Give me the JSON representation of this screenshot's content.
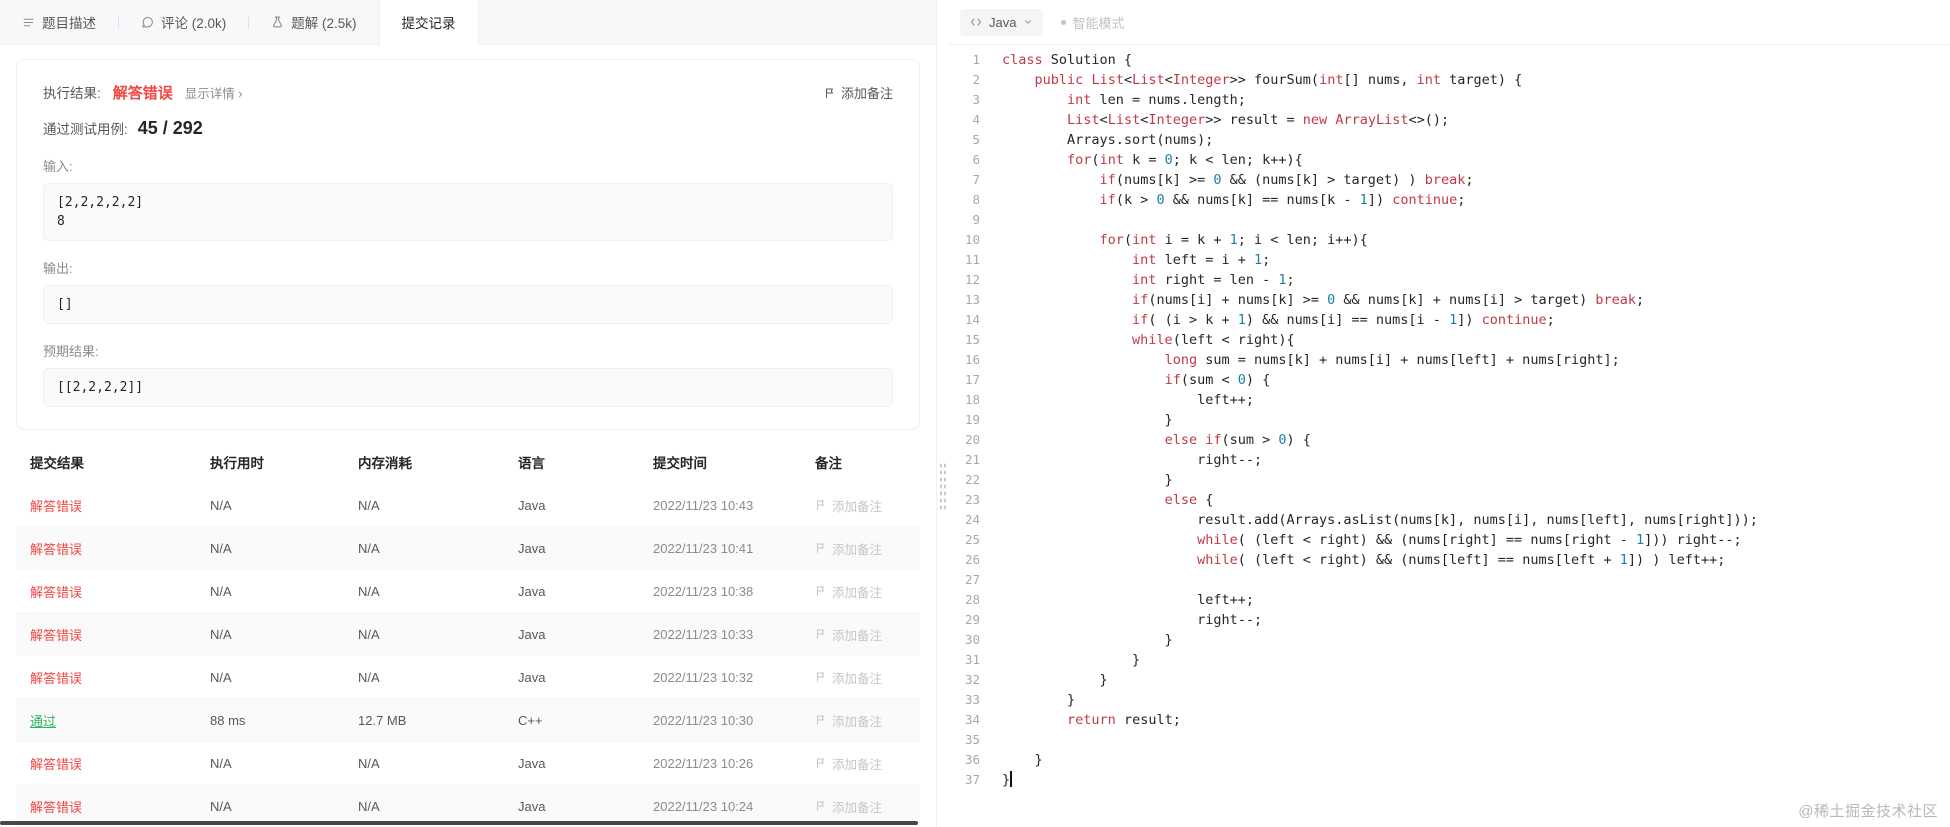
{
  "tabs": [
    {
      "label": "题目描述"
    },
    {
      "label": "评论 (2.0k)"
    },
    {
      "label": "题解 (2.5k)"
    },
    {
      "label": "提交记录"
    }
  ],
  "result": {
    "exec_label": "执行结果:",
    "status": "解答错误",
    "detail_link": "显示详情 ›",
    "add_note": "添加备注",
    "passed_label": "通过测试用例:",
    "passed_value": "45 / 292",
    "input_label": "输入:",
    "input_value": "[2,2,2,2,2]\n8",
    "output_label": "输出:",
    "output_value": "[]",
    "expected_label": "预期结果:",
    "expected_value": "[[2,2,2,2]]"
  },
  "table": {
    "headers": [
      "提交结果",
      "执行用时",
      "内存消耗",
      "语言",
      "提交时间",
      "备注"
    ],
    "rows": [
      {
        "result": "解答错误",
        "status": "error",
        "runtime": "N/A",
        "memory": "N/A",
        "lang": "Java",
        "time": "2022/11/23 10:43",
        "note": "添加备注"
      },
      {
        "result": "解答错误",
        "status": "error",
        "runtime": "N/A",
        "memory": "N/A",
        "lang": "Java",
        "time": "2022/11/23 10:41",
        "note": "添加备注"
      },
      {
        "result": "解答错误",
        "status": "error",
        "runtime": "N/A",
        "memory": "N/A",
        "lang": "Java",
        "time": "2022/11/23 10:38",
        "note": "添加备注"
      },
      {
        "result": "解答错误",
        "status": "error",
        "runtime": "N/A",
        "memory": "N/A",
        "lang": "Java",
        "time": "2022/11/23 10:33",
        "note": "添加备注"
      },
      {
        "result": "解答错误",
        "status": "error",
        "runtime": "N/A",
        "memory": "N/A",
        "lang": "Java",
        "time": "2022/11/23 10:32",
        "note": "添加备注"
      },
      {
        "result": "通过",
        "status": "success",
        "runtime": "88 ms",
        "memory": "12.7 MB",
        "lang": "C++",
        "time": "2022/11/23 10:30",
        "note": "添加备注"
      },
      {
        "result": "解答错误",
        "status": "error",
        "runtime": "N/A",
        "memory": "N/A",
        "lang": "Java",
        "time": "2022/11/23 10:26",
        "note": "添加备注"
      },
      {
        "result": "解答错误",
        "status": "error",
        "runtime": "N/A",
        "memory": "N/A",
        "lang": "Java",
        "time": "2022/11/23 10:24",
        "note": "添加备注"
      }
    ]
  },
  "editor": {
    "language": "Java",
    "mode": "智能模式",
    "code_lines": [
      "class Solution {",
      "    public List<List<Integer>> fourSum(int[] nums, int target) {",
      "        int len = nums.length;",
      "        List<List<Integer>> result = new ArrayList<>();",
      "        Arrays.sort(nums);",
      "        for(int k = 0; k < len; k++){",
      "            if(nums[k] >= 0 && (nums[k] > target) ) break;",
      "            if(k > 0 && nums[k] == nums[k - 1]) continue;",
      "",
      "            for(int i = k + 1; i < len; i++){",
      "                int left = i + 1;",
      "                int right = len - 1;",
      "                if(nums[i] + nums[k] >= 0 && nums[k] + nums[i] > target) break;",
      "                if( (i > k + 1) && nums[i] == nums[i - 1]) continue;",
      "                while(left < right){",
      "                    long sum = nums[k] + nums[i] + nums[left] + nums[right];",
      "                    if(sum < 0) {",
      "                        left++;",
      "                    }",
      "                    else if(sum > 0) {",
      "                        right--;",
      "                    }",
      "                    else {",
      "                        result.add(Arrays.asList(nums[k], nums[i], nums[left], nums[right]));",
      "                        while( (left < right) && (nums[right] == nums[right - 1])) right--;",
      "                        while( (left < right) && (nums[left] == nums[left + 1]) ) left++;",
      "",
      "                        left++;",
      "                        right--;",
      "                    }",
      "                }",
      "            }",
      "        }",
      "        return result;",
      "",
      "    }",
      "}"
    ]
  },
  "watermark": "@稀土掘金技术社区",
  "colors": {
    "error": "#ef4743",
    "success": "#2db55d",
    "keyword": "#c03a47",
    "number": "#1b7fa8"
  }
}
